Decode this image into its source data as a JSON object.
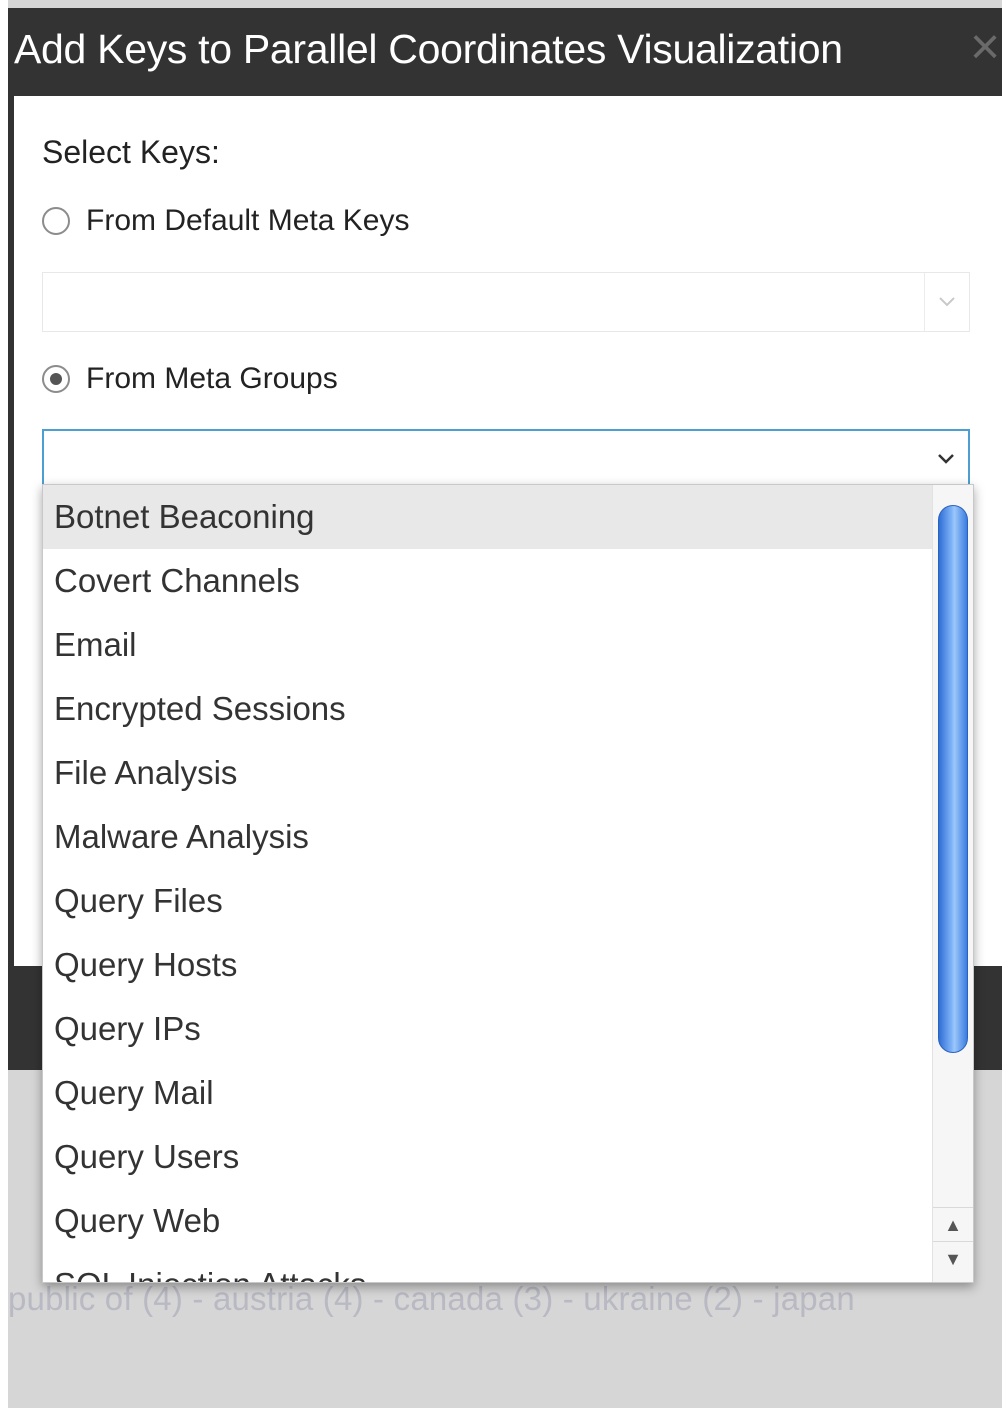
{
  "dialog": {
    "title": "Add Keys to Parallel Coordinates Visualization",
    "close_icon": "close-icon"
  },
  "form": {
    "section_label": "Select Keys:",
    "default_option_label": "From Default Meta Keys",
    "default_option_checked": false,
    "default_select_value": "",
    "groups_option_label": "From Meta Groups",
    "groups_option_checked": true,
    "groups_select_value": ""
  },
  "dropdown": {
    "highlighted_index": 0,
    "options": [
      "Botnet Beaconing",
      "Covert Channels",
      "Email",
      "Encrypted Sessions",
      "File Analysis",
      "Malware Analysis",
      "Query Files",
      "Query Hosts",
      "Query IPs",
      "Query Mail",
      "Query Users",
      "Query Web",
      "SQL Injection Attacks"
    ],
    "scroll_up_icon": "arrow-up-icon",
    "scroll_down_icon": "arrow-down-icon"
  },
  "background": {
    "text": "public of (4) - austria (4) - canada (3) - ukraine (2) - japan"
  },
  "colors": {
    "titlebar": "#333333",
    "focus_border": "#4d9fd1",
    "scroll_thumb": "#4f8ff0"
  }
}
